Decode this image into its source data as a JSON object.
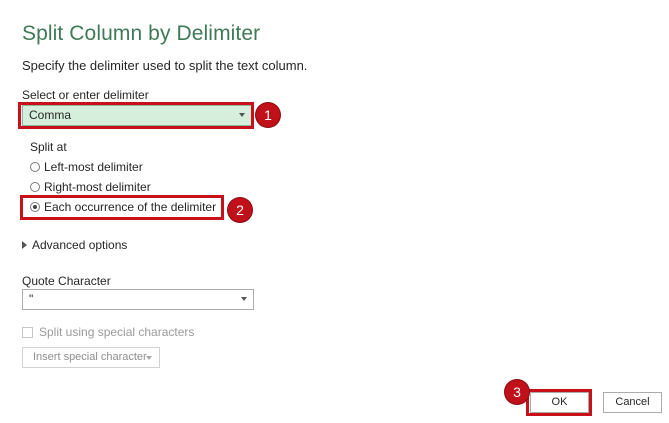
{
  "dialog": {
    "title": "Split Column by Delimiter",
    "subtitle": "Specify the delimiter used to split the text column."
  },
  "delimiter": {
    "label": "Select or enter delimiter",
    "value": "Comma"
  },
  "split_at": {
    "label": "Split at",
    "options": [
      {
        "label": "Left-most delimiter",
        "checked": false
      },
      {
        "label": "Right-most delimiter",
        "checked": false
      },
      {
        "label": "Each occurrence of the delimiter",
        "checked": true
      }
    ]
  },
  "advanced": {
    "label": "Advanced options"
  },
  "quote": {
    "label": "Quote Character",
    "value": "\""
  },
  "special": {
    "checkbox_label": "Split using special characters",
    "insert_label": "Insert special character"
  },
  "buttons": {
    "ok": "OK",
    "cancel": "Cancel"
  },
  "annotations": {
    "badge1": "1",
    "badge2": "2",
    "badge3": "3",
    "color": "#c8101a"
  }
}
